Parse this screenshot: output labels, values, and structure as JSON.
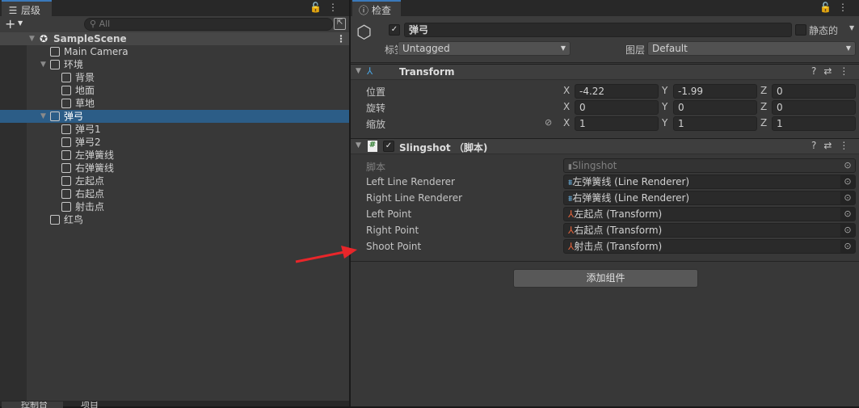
{
  "hierarchy": {
    "tab_label": "层级",
    "search_placeholder": "All",
    "add_label": "+",
    "scene": "SampleScene",
    "items": [
      {
        "label": "Main Camera",
        "depth": 1,
        "expand": false
      },
      {
        "label": "环境",
        "depth": 1,
        "expand": true
      },
      {
        "label": "背景",
        "depth": 2,
        "expand": false
      },
      {
        "label": "地面",
        "depth": 2,
        "expand": false
      },
      {
        "label": "草地",
        "depth": 2,
        "expand": false
      },
      {
        "label": "弹弓",
        "depth": 1,
        "expand": true,
        "selected": true
      },
      {
        "label": "弹弓1",
        "depth": 2,
        "expand": false
      },
      {
        "label": "弹弓2",
        "depth": 2,
        "expand": false
      },
      {
        "label": "左弹簧线",
        "depth": 2,
        "expand": false
      },
      {
        "label": "右弹簧线",
        "depth": 2,
        "expand": false
      },
      {
        "label": "左起点",
        "depth": 2,
        "expand": false
      },
      {
        "label": "右起点",
        "depth": 2,
        "expand": false
      },
      {
        "label": "射击点",
        "depth": 2,
        "expand": false
      },
      {
        "label": "红鸟",
        "depth": 1,
        "expand": false
      }
    ],
    "bottom_tabs": [
      "控制台",
      "项目"
    ]
  },
  "inspector": {
    "tab_label": "检查器",
    "object_name": "弹弓",
    "active": true,
    "static_label": "静态的",
    "tag_label": "标签",
    "tag_value": "Untagged",
    "layer_label": "图层",
    "layer_value": "Default",
    "transform": {
      "title": "Transform",
      "rows": [
        {
          "label": "位置",
          "x": "-4.22",
          "y": "-1.99",
          "z": "0"
        },
        {
          "label": "旋转",
          "x": "0",
          "y": "0",
          "z": "0"
        },
        {
          "label": "缩放",
          "x": "1",
          "y": "1",
          "z": "1"
        }
      ]
    },
    "script": {
      "title": "Slingshot （脚本)",
      "enabled": true,
      "script_label": "脚本",
      "script_value": "Slingshot",
      "fields": [
        {
          "label": "Left Line Renderer",
          "value": "左弹簧线 (Line Renderer)",
          "icon": "line-renderer"
        },
        {
          "label": "Right Line Renderer",
          "value": "右弹簧线 (Line Renderer)",
          "icon": "line-renderer"
        },
        {
          "label": "Left Point",
          "value": "左起点 (Transform)",
          "icon": "transform"
        },
        {
          "label": "Right Point",
          "value": "右起点 (Transform)",
          "icon": "transform"
        },
        {
          "label": "Shoot Point",
          "value": "射击点 (Transform)",
          "icon": "transform"
        }
      ]
    },
    "add_component": "添加组件"
  },
  "colors": {
    "selection": "#2c5d87",
    "annotation_arrow": "#e8262a",
    "tab_accent": "#3a79bb"
  }
}
